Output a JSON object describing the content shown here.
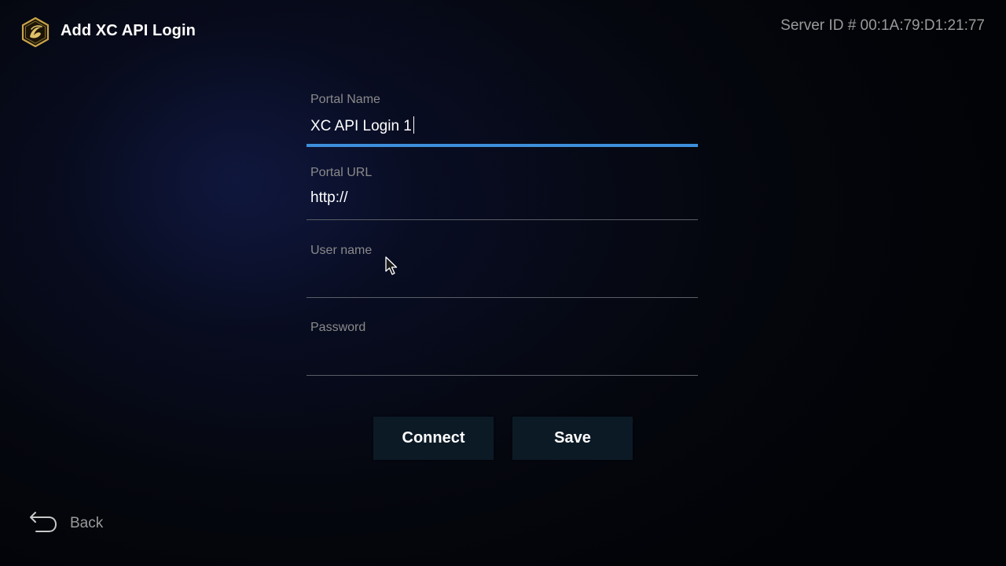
{
  "header": {
    "title": "Add XC API Login",
    "server_id": "Server ID # 00:1A:79:D1:21:77",
    "logo_icon": "app-logo-icon"
  },
  "form": {
    "portal_name": {
      "label": "Portal Name",
      "value": "XC API Login 1",
      "focused": true
    },
    "portal_url": {
      "label": "Portal URL",
      "value": "http://"
    },
    "user_name": {
      "label": "User name",
      "value": ""
    },
    "password": {
      "label": "Password",
      "value": ""
    }
  },
  "actions": {
    "connect_label": "Connect",
    "save_label": "Save"
  },
  "footer": {
    "back_label": "Back",
    "back_icon": "back-arrow-icon"
  },
  "colors": {
    "focus_accent": "#3d8fdb",
    "logo_gold": "#c9a44a",
    "button_bg": "#0c1a26",
    "label_gray": "#8a8a8a"
  }
}
